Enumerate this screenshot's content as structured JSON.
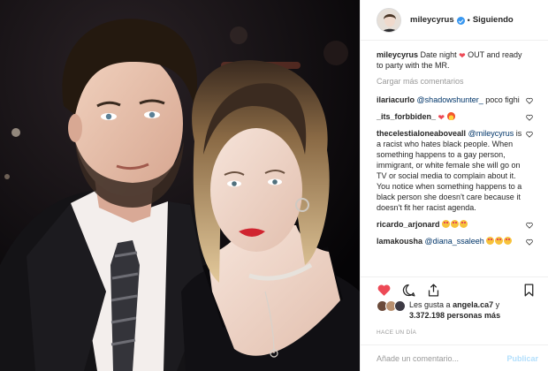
{
  "header": {
    "username": "mileycyrus",
    "separator": "•",
    "follow_status": "Siguiendo"
  },
  "caption": {
    "username": "mileycyrus",
    "text_before_emoji": "Date night",
    "text_after_emoji": "OUT and ready to party with the MR.",
    "emoji": "heart"
  },
  "load_more": "Cargar más comentarios",
  "comments": [
    {
      "username": "ilariacurlo",
      "mention": "@shadowshunter_",
      "text": "poco fighi",
      "emojis": []
    },
    {
      "username": "_its_forbbiden_",
      "mention": "",
      "text": "",
      "emojis": [
        "heart",
        "fire"
      ]
    },
    {
      "username": "thecelestialoneaboveall",
      "mention": "@mileycyrus",
      "text": "is a racist who hates black people. When something happens to a gay person, immigrant, or white female she will go on TV or social media to complain about it. You notice when something happens to a black person she doesn't care because it doesn't fit her racist agenda.",
      "emojis": []
    },
    {
      "username": "ricardo_arjonard",
      "mention": "",
      "text": "",
      "emojis": [
        "heart-eyes",
        "heart-eyes",
        "heart-eyes"
      ]
    },
    {
      "username": "lamakousha",
      "mention": "@diana_ssaleeh",
      "text": "",
      "emojis": [
        "heart-eyes",
        "heart-eyes",
        "heart-eyes"
      ]
    }
  ],
  "actions": {
    "like_icon": "heart-filled-icon",
    "comment_icon": "comment-icon",
    "share_icon": "share-icon",
    "save_icon": "bookmark-icon"
  },
  "likes": {
    "prefix": "Les gusta a",
    "user": "angela.ca7",
    "connector": "y",
    "count": "3.372.198 personas más"
  },
  "time_ago": "HACE UN DÍA",
  "add_comment": {
    "placeholder": "Añade un comentario...",
    "publish_label": "Publicar"
  },
  "colors": {
    "like_red": "#ed4956",
    "link_blue": "#003569",
    "verified_blue": "#3897f0",
    "publish_disabled": "#b2dffc",
    "muted": "#999999"
  }
}
